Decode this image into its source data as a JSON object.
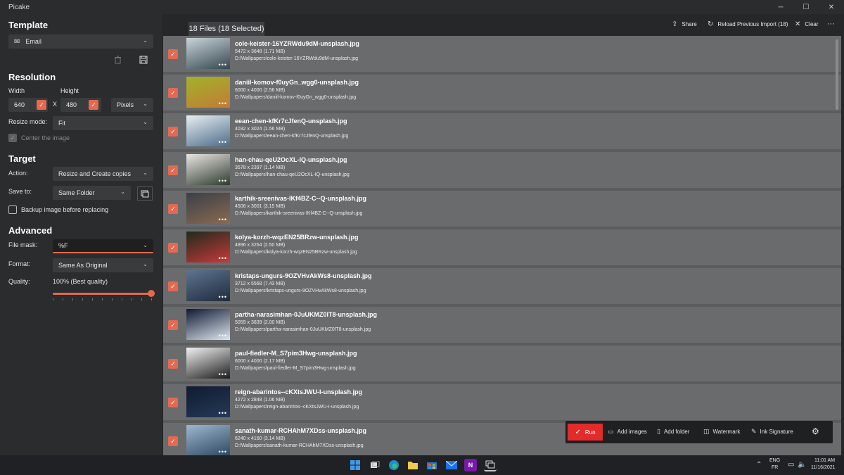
{
  "app": {
    "title": "Picake"
  },
  "window_controls": {
    "minimize": "─",
    "maximize": "☐",
    "close": "✕"
  },
  "left": {
    "template": {
      "title": "Template",
      "value": "Email"
    },
    "resolution": {
      "title": "Resolution",
      "width_label": "Width",
      "height_label": "Height",
      "width_value": "640",
      "height_value": "480",
      "x_label": "X",
      "unit": "Pixels",
      "resize_mode_label": "Resize mode:",
      "resize_mode_value": "Fit",
      "center_image_label": "Center the image"
    },
    "target": {
      "title": "Target",
      "action_label": "Action:",
      "action_value": "Resize and Create copies",
      "save_to_label": "Save to:",
      "save_to_value": "Same Folder",
      "backup_label": "Backup image before replacing"
    },
    "advanced": {
      "title": "Advanced",
      "file_mask_label": "File mask:",
      "file_mask_value": "%F",
      "format_label": "Format:",
      "format_value": "Same As Original",
      "quality_label": "Quality:",
      "quality_value_text": "100% (Best quality)",
      "quality_value": 100
    }
  },
  "header": {
    "files_tab": "18 Files (18 Selected)",
    "share": "Share",
    "reload": "Reload Previous Import (18)",
    "clear": "Clear",
    "more": "···"
  },
  "files": [
    {
      "name": "cole-keister-16YZRWdu9dM-unsplash.jpg",
      "dims": "5472 x 3648 (1.71 MB)",
      "path": "D:\\Wallpapers\\cole-keister-16YZRWdu9dM-unsplash.jpg",
      "colors": [
        "#c9d4da",
        "#35474f"
      ]
    },
    {
      "name": "daniil-komov-f0uyGn_wgg0-unsplash.jpg",
      "dims": "6000 x 4000 (2.56 MB)",
      "path": "D:\\Wallpapers\\daniil-komov-f0uyGn_wgg0-unsplash.jpg",
      "colors": [
        "#a0b32a",
        "#c47a36"
      ]
    },
    {
      "name": "eean-chen-kfKr7cJfenQ-unsplash.jpg",
      "dims": "4032 x 3024 (1.56 MB)",
      "path": "D:\\Wallpapers\\eean-chen-kfKr7cJfenQ-unsplash.jpg",
      "colors": [
        "#e8eef2",
        "#4c6d8a"
      ]
    },
    {
      "name": "han-chau-qeU2OcXL-IQ-unsplash.jpg",
      "dims": "3578 x 2397 (1.14 MB)",
      "path": "D:\\Wallpapers\\han-chau-qeU2OcXL-IQ-unsplash.jpg",
      "colors": [
        "#e9e7e2",
        "#2f3b2f"
      ]
    },
    {
      "name": "karthik-sreenivas-IKf4BZ-C--Q-unsplash.jpg",
      "dims": "4506 x 3001 (3.15 MB)",
      "path": "D:\\Wallpapers\\karthik-sreenivas-IKf4BZ-C--Q-unsplash.jpg",
      "colors": [
        "#3b3f47",
        "#8a6a52"
      ]
    },
    {
      "name": "kolya-korzh-wqzEN25BRzw-unsplash.jpg",
      "dims": "4896 x 3264 (2.50 MB)",
      "path": "D:\\Wallpapers\\kolya-korzh-wqzEN25BRzw-unsplash.jpg",
      "colors": [
        "#1f2a1c",
        "#c83a3a"
      ]
    },
    {
      "name": "kristaps-ungurs-9OZVHvAkWs8-unsplash.jpg",
      "dims": "3712 x 5568 (7.43 MB)",
      "path": "D:\\Wallpapers\\kristaps-ungurs-9OZVHvAkWs8-unsplash.jpg",
      "colors": [
        "#5d7490",
        "#1e2b3e"
      ]
    },
    {
      "name": "partha-narasimhan-0JuUKMZ0lT8-unsplash.jpg",
      "dims": "5059 x 3839 (2.00 MB)",
      "path": "D:\\Wallpapers\\partha-narasimhan-0JuUKMZ0lT8-unsplash.jpg",
      "colors": [
        "#0d1a33",
        "#dfe6ee"
      ]
    },
    {
      "name": "paul-fiedler-M_S7pim3Hwg-unsplash.jpg",
      "dims": "6000 x 4000 (2.17 MB)",
      "path": "D:\\Wallpapers\\paul-fiedler-M_S7pim3Hwg-unsplash.jpg",
      "colors": [
        "#f2f2f2",
        "#1c1c1c"
      ]
    },
    {
      "name": "reign-abarintos--cKXtsJWU-I-unsplash.jpg",
      "dims": "4272 x 2848 (1.06 MB)",
      "path": "D:\\Wallpapers\\reign-abarintos--cKXtsJWU-I-unsplash.jpg",
      "colors": [
        "#111b2e",
        "#233a5a"
      ]
    },
    {
      "name": "sanath-kumar-RCHAhM7XDss-unsplash.jpg",
      "dims": "6240 x 4160 (3.14 MB)",
      "path": "D:\\Wallpapers\\sanath-kumar-RCHAhM7XDss-unsplash.jpg",
      "colors": [
        "#9fb7cf",
        "#2d4763"
      ]
    }
  ],
  "toolbar": {
    "run": "Run",
    "add_images": "Add images",
    "add_folder": "Add folder",
    "watermark": "Watermark",
    "ink_signature": "Ink Signature"
  },
  "taskbar": {
    "lang_top": "ENG",
    "lang_bottom": "FR",
    "time": "11:01 AM",
    "date": "11/16/2021",
    "onenote_letter": "N"
  },
  "accent_color": "#e36a50"
}
